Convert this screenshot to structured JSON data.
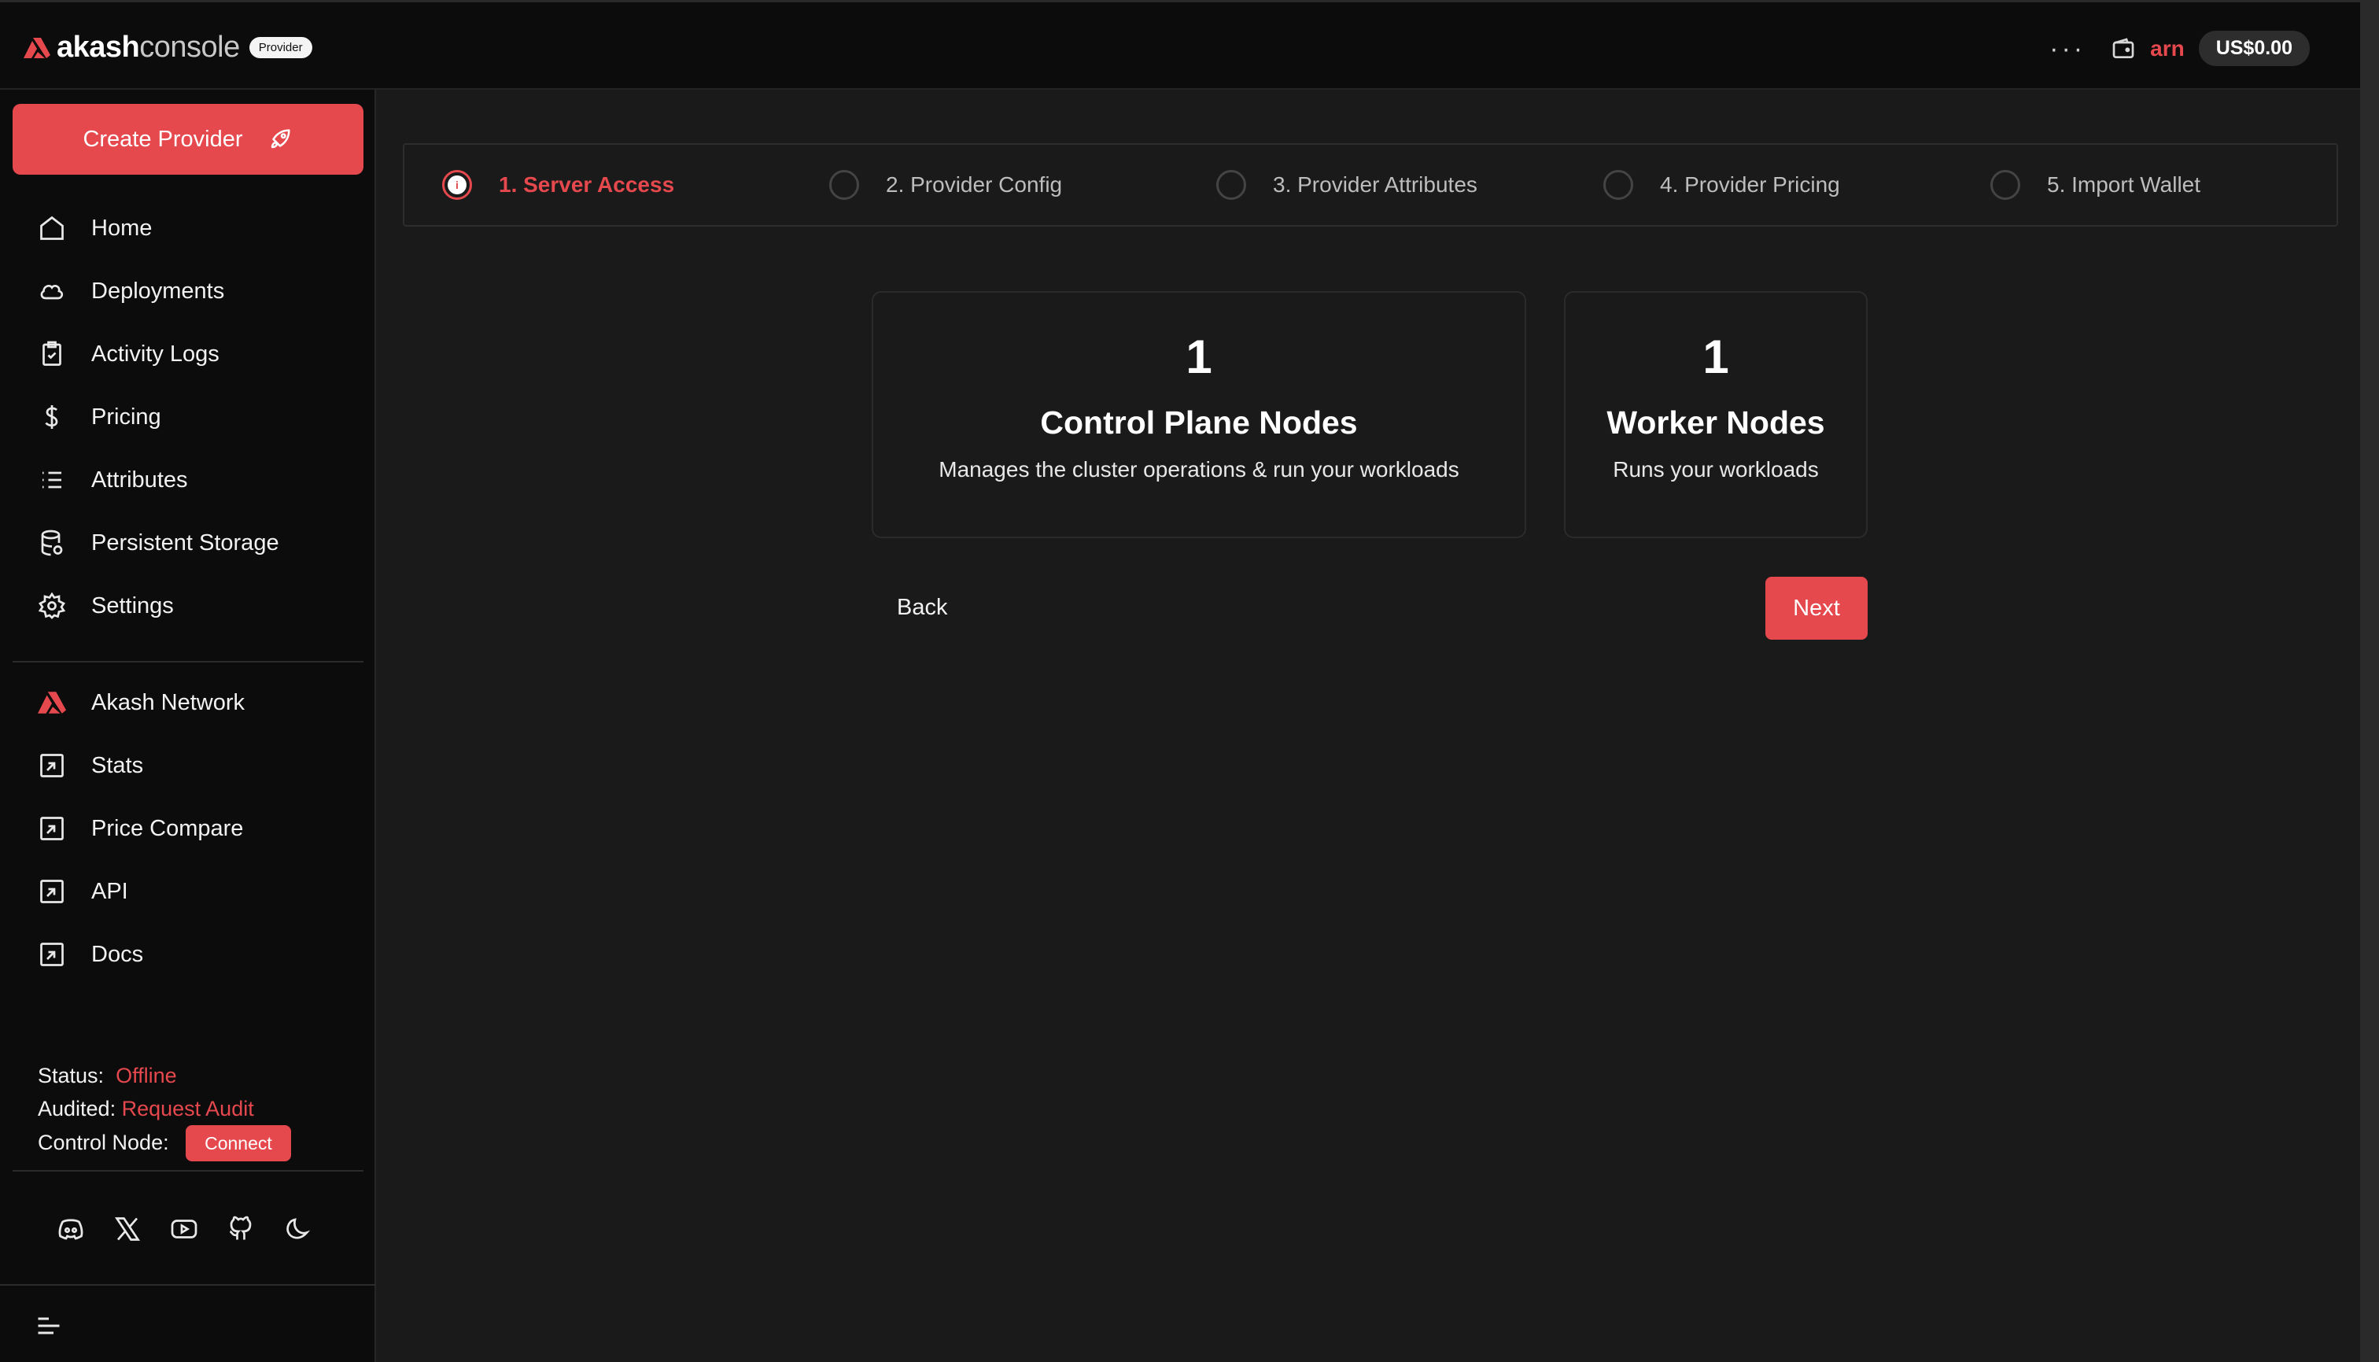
{
  "header": {
    "logo_bold": "akash",
    "logo_light": "console",
    "logo_badge": "Provider",
    "more_label": "···",
    "username": "arn",
    "balance": "US$0.00"
  },
  "sidebar": {
    "create_button": "Create Provider",
    "nav": [
      {
        "label": "Home",
        "icon": "home-icon"
      },
      {
        "label": "Deployments",
        "icon": "cloud-icon"
      },
      {
        "label": "Activity Logs",
        "icon": "clipboard-icon"
      },
      {
        "label": "Pricing",
        "icon": "dollar-icon"
      },
      {
        "label": "Attributes",
        "icon": "list-icon"
      },
      {
        "label": "Persistent Storage",
        "icon": "database-icon"
      },
      {
        "label": "Settings",
        "icon": "gear-icon"
      }
    ],
    "external": [
      {
        "label": "Akash Network",
        "icon": "akash-logo-icon"
      },
      {
        "label": "Stats",
        "icon": "external-link-icon"
      },
      {
        "label": "Price Compare",
        "icon": "external-link-icon"
      },
      {
        "label": "API",
        "icon": "external-link-icon"
      },
      {
        "label": "Docs",
        "icon": "external-link-icon"
      }
    ],
    "status": {
      "status_label": "Status:",
      "status_value": "Offline",
      "audited_label": "Audited:",
      "audited_value": "Request Audit",
      "control_label": "Control Node:",
      "connect_button": "Connect"
    }
  },
  "stepper": {
    "steps": [
      {
        "label": "1. Server Access",
        "active": true
      },
      {
        "label": "2. Provider Config",
        "active": false
      },
      {
        "label": "3. Provider Attributes",
        "active": false
      },
      {
        "label": "4. Provider Pricing",
        "active": false
      },
      {
        "label": "5. Import Wallet",
        "active": false
      }
    ],
    "active_glyph": "i"
  },
  "cards": [
    {
      "count": "1",
      "title": "Control Plane Nodes",
      "description": "Manages the cluster operations & run your workloads"
    },
    {
      "count": "1",
      "title": "Worker Nodes",
      "description": "Runs your workloads"
    }
  ],
  "actions": {
    "back": "Back",
    "next": "Next"
  },
  "colors": {
    "accent": "#e5484d",
    "background": "#1a1a1a",
    "sidebar": "#0c0c0c"
  }
}
